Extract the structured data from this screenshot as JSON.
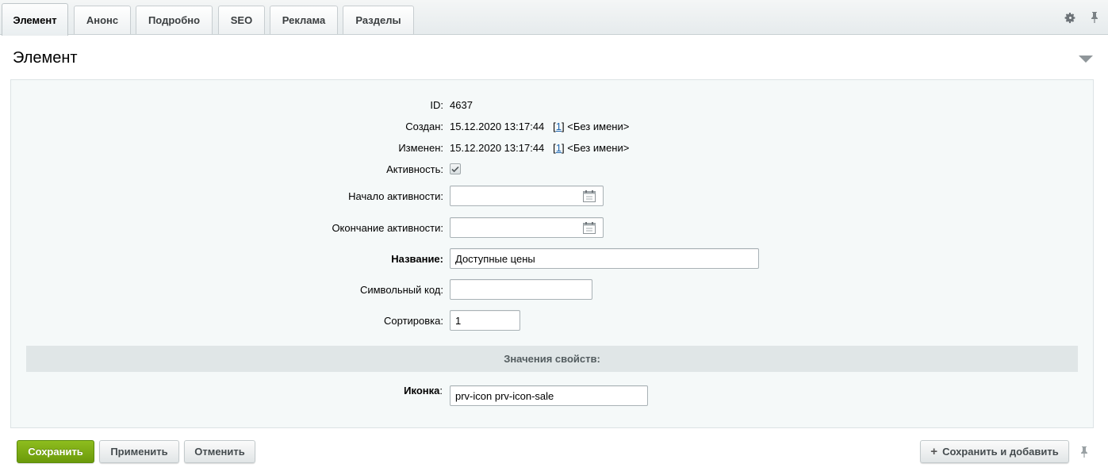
{
  "tabs": [
    {
      "label": "Элемент",
      "active": true
    },
    {
      "label": "Анонс"
    },
    {
      "label": "Подробно"
    },
    {
      "label": "SEO"
    },
    {
      "label": "Реклама"
    },
    {
      "label": "Разделы"
    }
  ],
  "toolbar": {
    "settings_icon": "gear-icon",
    "pin_icon": "pin-icon"
  },
  "section": {
    "title": "Элемент"
  },
  "form": {
    "id": {
      "label": "ID:",
      "value": "4637"
    },
    "created": {
      "label": "Создан:",
      "date": "15.12.2020 13:17:44",
      "user_open": "[",
      "user_id": "1",
      "user_close": "]",
      "user_name": "<Без имени>"
    },
    "modified": {
      "label": "Изменен:",
      "date": "15.12.2020 13:17:44",
      "user_open": "[",
      "user_id": "1",
      "user_close": "]",
      "user_name": "<Без имени>"
    },
    "active": {
      "label": "Активность:",
      "checked": true
    },
    "active_from": {
      "label": "Начало активности:",
      "value": ""
    },
    "active_to": {
      "label": "Окончание активности:",
      "value": ""
    },
    "name": {
      "label": "Название:",
      "value": "Доступные цены"
    },
    "code": {
      "label": "Символьный код:",
      "value": ""
    },
    "sort": {
      "label": "Сортировка:",
      "value": "1"
    },
    "properties_header": "Значения свойств:",
    "icon_prop": {
      "label": "Иконка",
      "colon": ":",
      "value": "prv-icon prv-icon-sale"
    }
  },
  "buttons": {
    "save": "Сохранить",
    "apply": "Применить",
    "cancel": "Отменить",
    "save_add": "Сохранить и добавить"
  },
  "colors": {
    "primary": "#7aab14",
    "link": "#2067b0"
  }
}
